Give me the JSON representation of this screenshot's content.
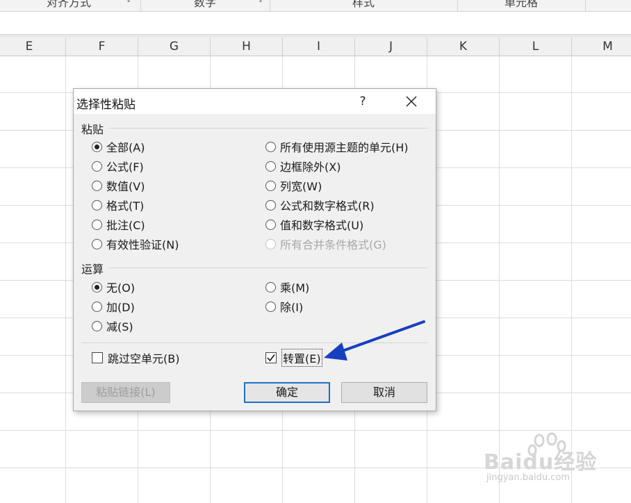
{
  "ribbon": {
    "groups": [
      "对齐方式",
      "数字",
      "样式",
      "单元格"
    ]
  },
  "columns": [
    "E",
    "F",
    "G",
    "H",
    "I",
    "J",
    "K",
    "L",
    "M"
  ],
  "dialog": {
    "title": "选择性粘贴",
    "help": "?",
    "paste_section": "粘贴",
    "paste_left": [
      {
        "label": "全部(A)",
        "checked": true
      },
      {
        "label": "公式(F)",
        "checked": false
      },
      {
        "label": "数值(V)",
        "checked": false
      },
      {
        "label": "格式(T)",
        "checked": false
      },
      {
        "label": "批注(C)",
        "checked": false
      },
      {
        "label": "有效性验证(N)",
        "checked": false
      }
    ],
    "paste_right": [
      {
        "label": "所有使用源主题的单元(H)",
        "disabled": false
      },
      {
        "label": "边框除外(X)",
        "disabled": false
      },
      {
        "label": "列宽(W)",
        "disabled": false
      },
      {
        "label": "公式和数字格式(R)",
        "disabled": false
      },
      {
        "label": "值和数字格式(U)",
        "disabled": false
      },
      {
        "label": "所有合并条件格式(G)",
        "disabled": true
      }
    ],
    "operation_section": "运算",
    "operation_left": [
      {
        "label": "无(O)",
        "checked": true
      },
      {
        "label": "加(D)",
        "checked": false
      },
      {
        "label": "减(S)",
        "checked": false
      }
    ],
    "operation_right": [
      {
        "label": "乘(M)"
      },
      {
        "label": "除(I)"
      }
    ],
    "skip_blanks": {
      "label": "跳过空单元(B)",
      "checked": false
    },
    "transpose": {
      "label": "转置(E)",
      "checked": true
    },
    "paste_link": "粘贴链接(L)",
    "ok": "确定",
    "cancel": "取消"
  },
  "annotation_arrow_color": "#1540c0",
  "watermark": {
    "text": "Baidu经验",
    "sub": "jingyan.baidu.com"
  }
}
